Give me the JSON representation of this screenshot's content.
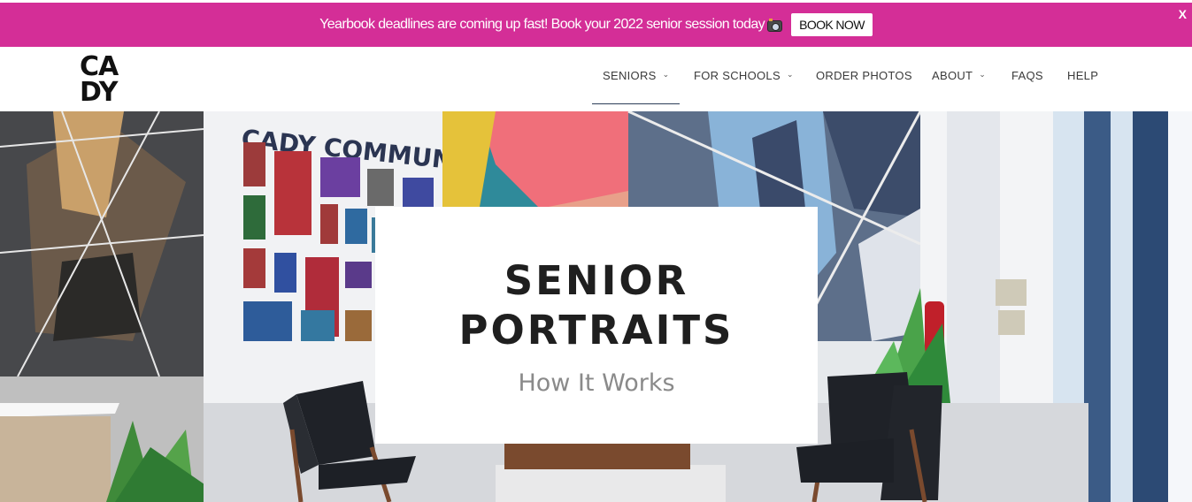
{
  "promo": {
    "text": "Yearbook deadlines are coming up fast! Book your 2022 senior session today",
    "icon": "camera-flash-icon",
    "button_label": "BOOK NOW",
    "close_label": "X",
    "background": "#d42e97"
  },
  "logo": {
    "line1": "CA",
    "line2": "DY"
  },
  "nav": {
    "items": [
      {
        "label": "SENIORS",
        "has_dropdown": true,
        "active": true
      },
      {
        "label": "FOR SCHOOLS",
        "has_dropdown": true
      },
      {
        "label": "ORDER PHOTOS",
        "has_dropdown": false
      },
      {
        "label": "ABOUT",
        "has_dropdown": true
      },
      {
        "label": "FAQS",
        "has_dropdown": false
      },
      {
        "label": "HELP",
        "has_dropdown": false
      }
    ],
    "chevron": "⌄"
  },
  "hero": {
    "wall_sign": "CADY COMMUNITY",
    "title_line1": "SENIOR",
    "title_line2": "PORTRAITS",
    "subtitle": "How It Works"
  }
}
